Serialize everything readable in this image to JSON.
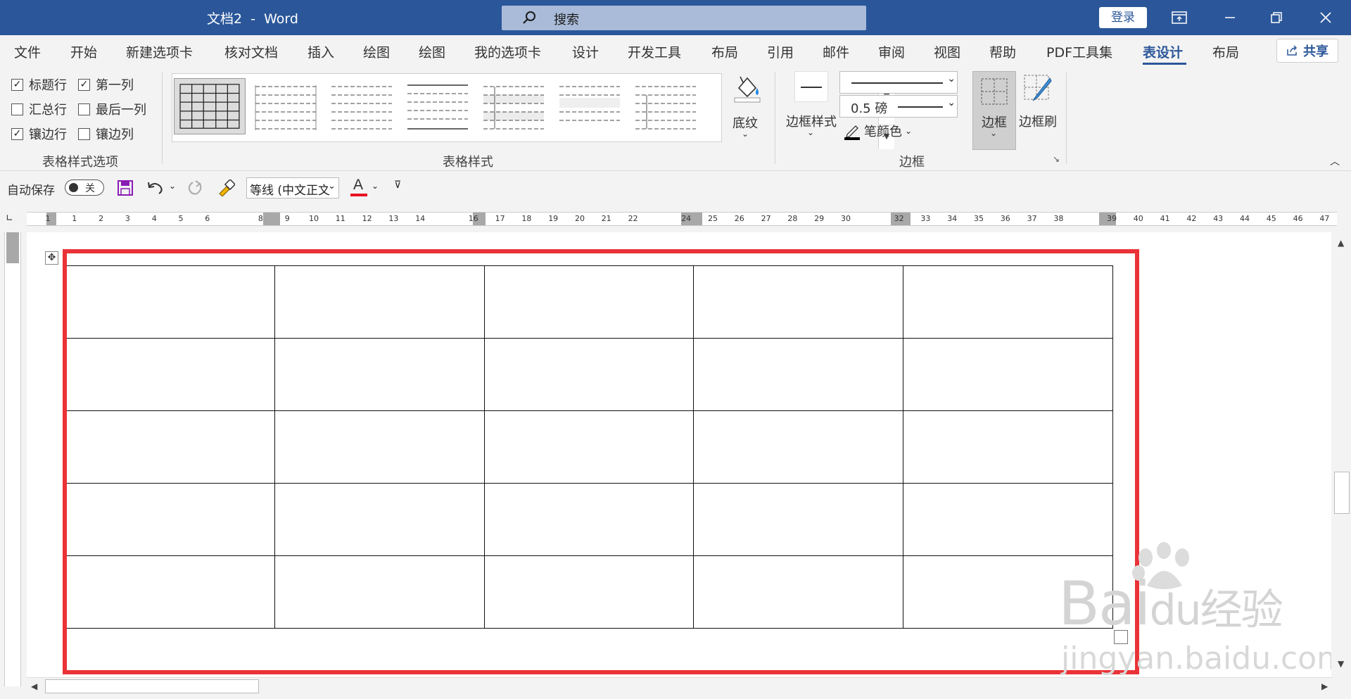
{
  "titlebar": {
    "doc_title": "文档2  -  Word",
    "search_label": "搜索",
    "login": "登录"
  },
  "menu": {
    "items": [
      "文件",
      "开始",
      "新建选项卡",
      "核对文档",
      "插入",
      "绘图",
      "绘图",
      "我的选项卡",
      "设计",
      "开发工具",
      "布局",
      "引用",
      "邮件",
      "审阅",
      "视图",
      "帮助",
      "PDF工具集",
      "表设计",
      "布局"
    ],
    "active_index": 17,
    "share": "共享"
  },
  "ribbon": {
    "options": {
      "header_row": {
        "label": "标题行",
        "checked": true
      },
      "first_column": {
        "label": "第一列",
        "checked": true
      },
      "total_row": {
        "label": "汇总行",
        "checked": false
      },
      "last_column": {
        "label": "最后一列",
        "checked": false
      },
      "banded_rows": {
        "label": "镶边行",
        "checked": true
      },
      "banded_columns": {
        "label": "镶边列",
        "checked": false
      },
      "group_label": "表格样式选项",
      "check_mark": "✓"
    },
    "styles": {
      "group_label": "表格样式",
      "shading": "底纹"
    },
    "borders": {
      "border_styles": "边框样式",
      "weight": "0.5 磅",
      "pen_color": "笔颜色",
      "borders": "边框",
      "border_painter": "边框刷",
      "group_label": "边框",
      "pen_color_value": "#000000"
    }
  },
  "qat": {
    "autosave": "自动保存",
    "toggle": "关",
    "font": "等线 (中文正文",
    "font_color_value": "#e81123"
  },
  "ruler": {
    "numbers": [
      "1",
      "1",
      "2",
      "3",
      "4",
      "5",
      "6",
      "8",
      "9",
      "10",
      "11",
      "12",
      "13",
      "14",
      "16",
      "17",
      "18",
      "19",
      "20",
      "21",
      "22",
      "24",
      "25",
      "26",
      "27",
      "28",
      "29",
      "30",
      "32",
      "33",
      "34",
      "35",
      "36",
      "37",
      "38",
      "39",
      "40",
      "41",
      "42",
      "43",
      "44",
      "45",
      "46",
      "47"
    ]
  },
  "document": {
    "table": {
      "rows": 5,
      "cols": 5
    },
    "highlight_color": "#ea3237"
  },
  "watermark": {
    "brand": "Bai",
    "brand2": "du",
    "cn": "经验",
    "url": "jingyan.baidu.com"
  },
  "colors": {
    "title_bar": "#2b579a",
    "accent": "#2b579a",
    "ribbon_bg": "#f3f3f3"
  }
}
